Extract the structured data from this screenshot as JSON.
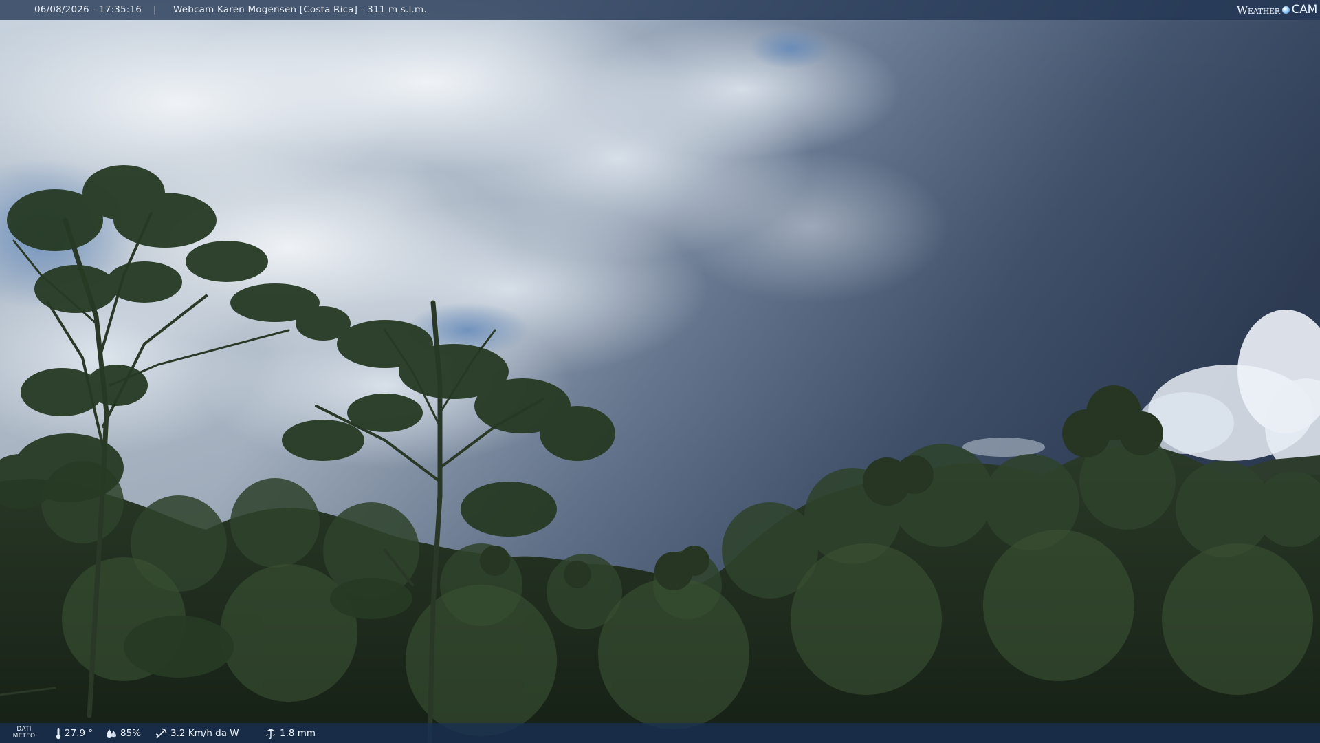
{
  "overlay_top": {
    "datetime": "06/08/2026 - 17:35:16",
    "separator": "|",
    "camera_title": "Webcam Karen Mogensen [Costa Rica]  - 311 m s.l.m.",
    "logo": {
      "word_left": "Weather",
      "word_right": "CAM"
    }
  },
  "overlay_bottom": {
    "section_label": "DATI METEO",
    "temperature": "27.9 °",
    "humidity": "85%",
    "wind": "3.2 Km/h da W",
    "rain": "1.8 mm"
  },
  "icons": [
    "thermometer-icon",
    "humidity-drop-icon",
    "wind-icon",
    "rain-gauge-icon",
    "weathercam-logo-icon"
  ],
  "colors": {
    "sky_light": "#dfe6ee",
    "sky_dark": "#3e4f6c",
    "foliage": "#1f2d1d",
    "bar": "#213452"
  }
}
